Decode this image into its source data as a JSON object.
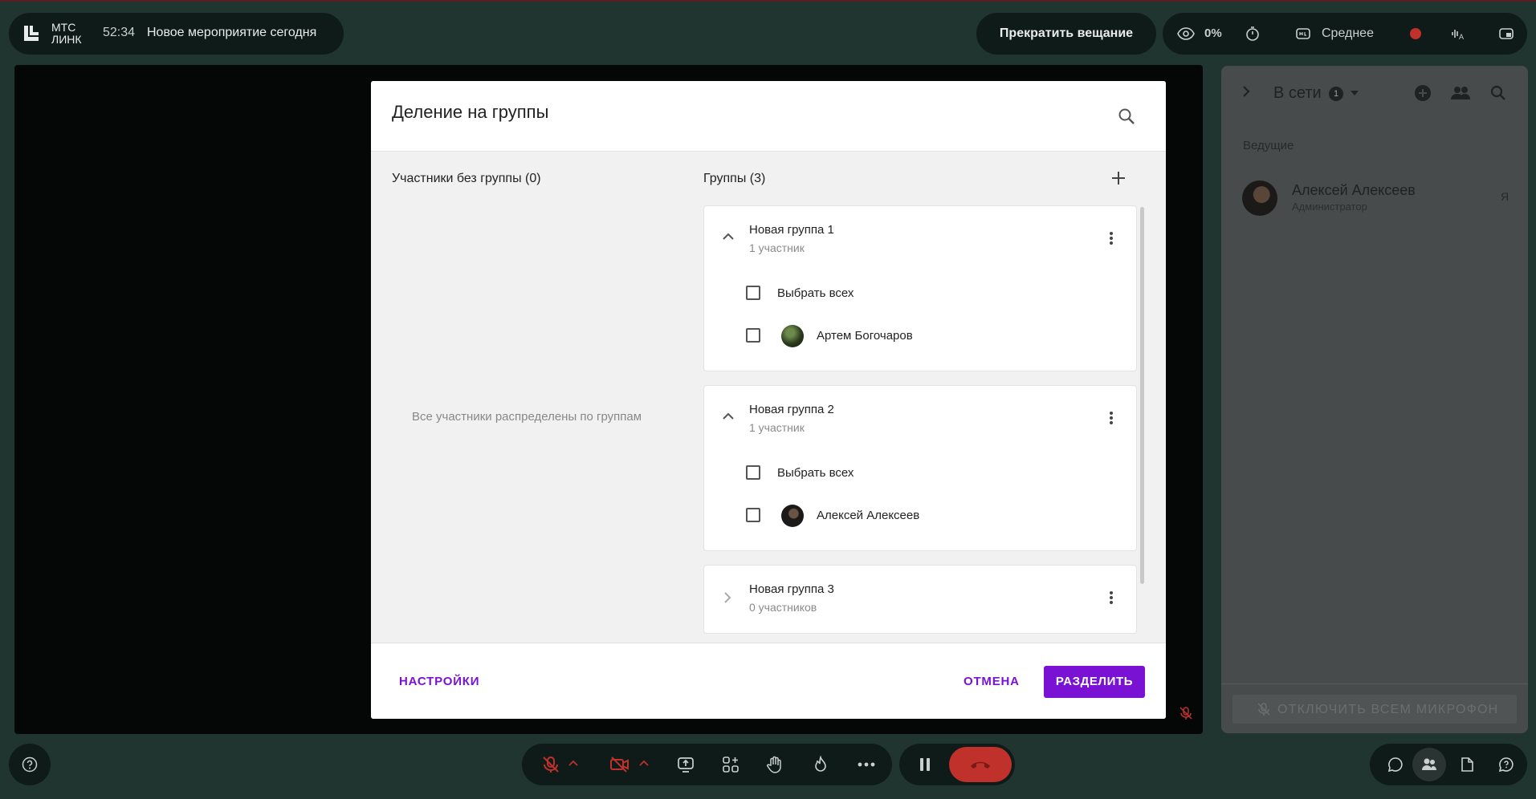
{
  "app": {
    "logo_line1": "МТС",
    "logo_line2": "ЛИНК",
    "timer": "52:34",
    "event_title": "Новое мероприятие сегодня"
  },
  "topbar": {
    "stop_broadcast": "Прекратить вещание",
    "viewers_percent": "0%",
    "quality": "Среднее"
  },
  "modal": {
    "title": "Деление на группы",
    "no_group_header": "Участники без группы (0)",
    "no_group_empty": "Все участники распределены по группам",
    "groups_header": "Группы (3)",
    "groups": [
      {
        "name": "Новая группа 1",
        "count": "1 участник",
        "expanded": true,
        "select_all": "Выбрать всех",
        "members": [
          "Артем Богочаров"
        ]
      },
      {
        "name": "Новая группа 2",
        "count": "1 участник",
        "expanded": true,
        "select_all": "Выбрать всех",
        "members": [
          "Алексей Алексеев"
        ]
      },
      {
        "name": "Новая группа 3",
        "count": "0 участников",
        "expanded": false
      }
    ],
    "settings_button": "НАСТРОЙКИ",
    "cancel_button": "ОТМЕНА",
    "split_button": "РАЗДЕЛИТЬ"
  },
  "sidebar": {
    "online_label": "В сети",
    "online_count": "1",
    "section_hosts": "Ведущие",
    "user_name": "Алексей Алексеев",
    "user_role": "Администратор",
    "me_label": "Я",
    "mute_all": "ОТКЛЮЧИТЬ ВСЕМ МИКРОФОН"
  },
  "colors": {
    "accent": "#7a12d4",
    "end_call": "#c0312b",
    "background": "#203430",
    "record": "#c0312b"
  }
}
